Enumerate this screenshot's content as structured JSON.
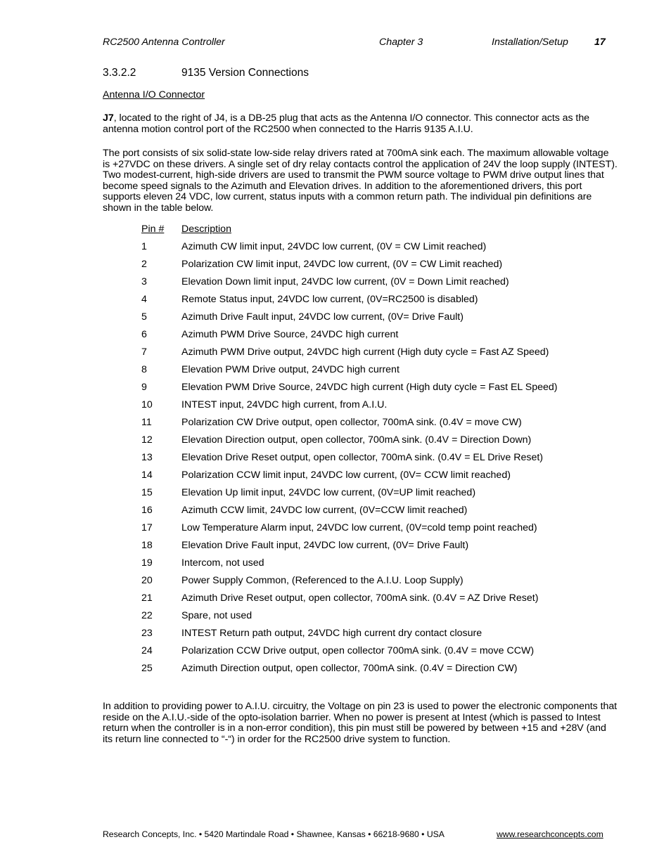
{
  "header": {
    "title": "RC2500 Antenna Controller",
    "chapter": "Chapter 3",
    "section": "Installation/Setup",
    "page_number": "17"
  },
  "section": {
    "number": "3.3.2.2",
    "title": "9135 Version Connections"
  },
  "subheading": "Antenna I/O Connector",
  "paragraphs": {
    "intro_bold": "J7",
    "intro_rest": ", located to the right of J4, is a DB-25 plug that acts as the Antenna I/O connector.  This connector acts as the antenna motion control port of the RC2500 when connected to the Harris 9135 A.I.U.",
    "description": "The port consists of six solid-state low-side relay drivers rated at 700mA sink each.  The maximum allowable voltage is +27VDC on these drivers.  A single set of dry relay contacts control the application of 24V the loop supply (INTEST).  Two modest-current, high-side drivers are used to transmit the PWM source voltage to PWM drive output lines that become speed signals to the Azimuth and Elevation drives.  In addition to the aforementioned drivers, this port supports eleven 24 VDC, low current, status inputs with a common return path.  The individual pin definitions are shown in the table below.",
    "closing": "In addition to providing power to A.I.U. circuitry, the Voltage on pin 23 is used to power the electronic components that reside on the A.I.U.-side of the opto-isolation barrier.  When no power is present at Intest (which is passed to Intest return when the controller is in a non-error condition), this pin must still be powered by between +15 and +28V (and its return line connected to “-“) in order for the RC2500 drive system to function."
  },
  "pin_table": {
    "headers": {
      "pin": "Pin #",
      "description": "Description"
    },
    "rows": [
      {
        "pin": "1",
        "description": "Azimuth CW limit input, 24VDC low current, (0V = CW Limit reached)"
      },
      {
        "pin": "2",
        "description": "Polarization CW limit input, 24VDC low current, (0V = CW Limit reached)"
      },
      {
        "pin": "3",
        "description": "Elevation Down limit input, 24VDC low current, (0V = Down Limit reached)"
      },
      {
        "pin": "4",
        "description": "Remote Status input, 24VDC low current, (0V=RC2500 is disabled)"
      },
      {
        "pin": "5",
        "description": "Azimuth Drive Fault input, 24VDC low current, (0V= Drive Fault)"
      },
      {
        "pin": "6",
        "description": "Azimuth PWM Drive Source, 24VDC high current"
      },
      {
        "pin": "7",
        "description": "Azimuth PWM Drive output, 24VDC high current (High duty cycle = Fast AZ Speed)"
      },
      {
        "pin": "8",
        "description": "Elevation PWM Drive output, 24VDC high current"
      },
      {
        "pin": "9",
        "description": "Elevation PWM Drive Source, 24VDC high current (High duty cycle = Fast EL Speed)"
      },
      {
        "pin": "10",
        "description": "INTEST input, 24VDC high current, from A.I.U."
      },
      {
        "pin": "11",
        "description": "Polarization CW Drive output, open collector, 700mA sink. (0.4V  = move CW)"
      },
      {
        "pin": "12",
        "description": "Elevation Direction output, open collector, 700mA sink. (0.4V  = Direction Down)"
      },
      {
        "pin": "13",
        "description": "Elevation Drive Reset output, open collector, 700mA sink. (0.4V  = EL Drive Reset)"
      },
      {
        "pin": "14",
        "description": "Polarization CCW limit input, 24VDC low current, (0V= CCW limit reached)"
      },
      {
        "pin": "15",
        "description": "Elevation Up limit input, 24VDC low current, (0V=UP limit reached)"
      },
      {
        "pin": "16",
        "description": "Azimuth CCW limit, 24VDC low current, (0V=CCW limit reached)"
      },
      {
        "pin": "17",
        "description": "Low Temperature Alarm input, 24VDC low current, (0V=cold temp point reached)"
      },
      {
        "pin": "18",
        "description": "Elevation Drive Fault input, 24VDC low current, (0V= Drive Fault)"
      },
      {
        "pin": "19",
        "description": "Intercom, not used"
      },
      {
        "pin": "20",
        "description": "Power Supply Common, (Referenced to the A.I.U. Loop Supply)"
      },
      {
        "pin": "21",
        "description": "Azimuth Drive Reset output, open collector, 700mA sink. (0.4V  = AZ Drive Reset)"
      },
      {
        "pin": "22",
        "description": "Spare, not used"
      },
      {
        "pin": "23",
        "description": "INTEST Return path output, 24VDC high current dry contact closure"
      },
      {
        "pin": "24",
        "description": "Polarization CCW Drive output, open collector 700mA sink. (0.4V  = move CCW)"
      },
      {
        "pin": "25",
        "description": "Azimuth Direction output, open collector, 700mA sink. (0.4V  = Direction CW)"
      }
    ]
  },
  "footer": {
    "address": "Research Concepts, Inc. • 5420 Martindale Road • Shawnee, Kansas • 66218-9680 • USA",
    "url": "www.researchconcepts.com"
  }
}
